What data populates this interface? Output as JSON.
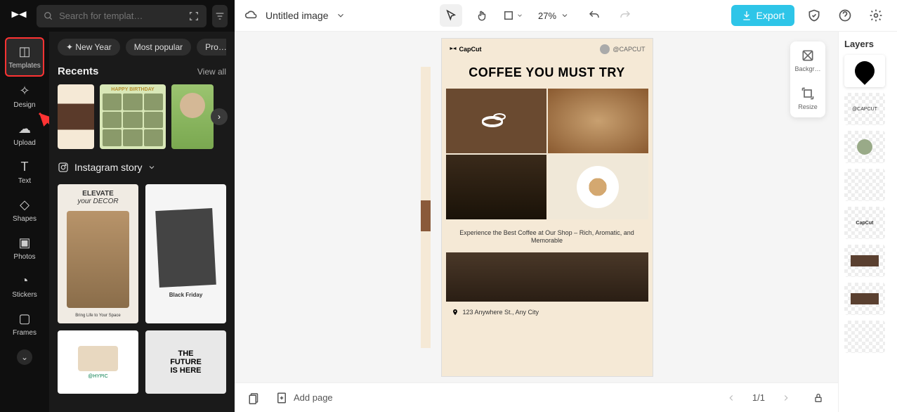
{
  "header": {
    "search_placeholder": "Search for templat…",
    "doc_title": "Untitled image",
    "zoom": "27%",
    "export_label": "Export"
  },
  "sidebar": {
    "items": [
      {
        "label": "Templates"
      },
      {
        "label": "Design"
      },
      {
        "label": "Upload"
      },
      {
        "label": "Text"
      },
      {
        "label": "Shapes"
      },
      {
        "label": "Photos"
      },
      {
        "label": "Stickers"
      },
      {
        "label": "Frames"
      }
    ]
  },
  "panel": {
    "chips": [
      "✦ New Year",
      "Most popular",
      "Pro…"
    ],
    "recents_title": "Recents",
    "view_all": "View all",
    "happy_birthday": "HAPPY BIRTHDAY",
    "category": "Instagram story",
    "decor": {
      "t1": "ELEVATE",
      "t2": "your DECOR",
      "t3": "Bring Life to Your Space"
    },
    "blackfriday": "Black Friday",
    "future": {
      "l1": "THE",
      "l2": "FUTURE",
      "l3": "IS HERE"
    },
    "sweater_hypic": "@HYPIC"
  },
  "canvas": {
    "brand": "CapCut",
    "handle": "@CAPCUT",
    "title": "COFFEE YOU MUST TRY",
    "subtitle": "Experience the Best Coffee at Our Shop – Rich, Aromatic, and Memorable",
    "address": "123 Anywhere St., Any City",
    "tools": {
      "bg": "Backgr…",
      "resize": "Resize"
    }
  },
  "bottom": {
    "add_page": "Add page",
    "page_indicator": "1/1"
  },
  "layers": {
    "title": "Layers",
    "items": [
      "pin",
      "@CAPCUT",
      "avatar",
      "subtitle",
      "CapCut",
      "shop",
      "shop2",
      "title"
    ]
  }
}
